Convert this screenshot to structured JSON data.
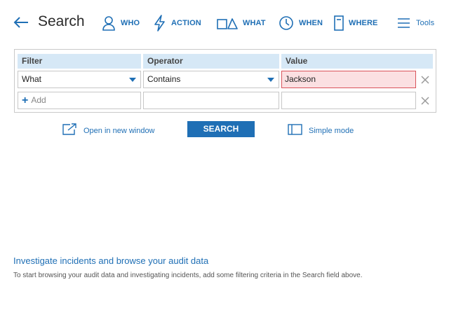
{
  "header": {
    "title": "Search",
    "nav": {
      "who": "WHO",
      "action": "ACTION",
      "what": "WHAT",
      "when": "WHEN",
      "where": "WHERE",
      "tools": "Tools"
    }
  },
  "filter_table": {
    "columns": [
      "Filter",
      "Operator",
      "Value"
    ],
    "rows": [
      {
        "filter": "What",
        "operator": "Contains",
        "value": "Jackson"
      }
    ],
    "add_label": "Add"
  },
  "actions": {
    "open_new_window": "Open in new window",
    "search": "SEARCH",
    "simple_mode": "Simple mode"
  },
  "info": {
    "title": "Investigate incidents and browse your audit data",
    "text": "To start browsing your audit data and investigating incidents, add some filtering criteria in the Search field above."
  },
  "colors": {
    "accent": "#1f6fb5",
    "header_bg": "#d6e8f6",
    "error_bg": "#fbe0e2",
    "error_border": "#d9535a"
  }
}
